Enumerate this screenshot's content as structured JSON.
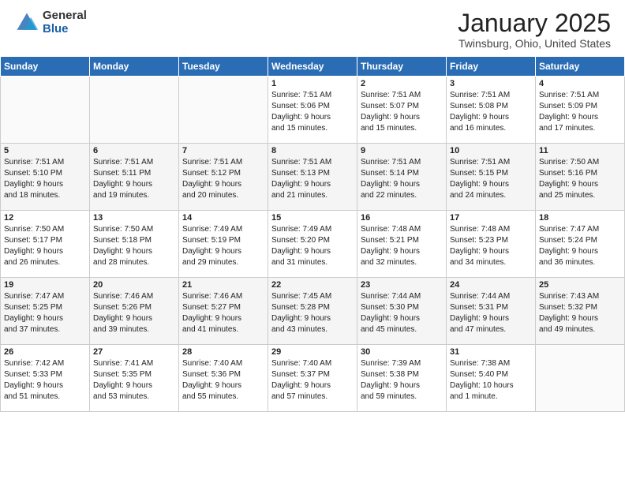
{
  "logo": {
    "general": "General",
    "blue": "Blue"
  },
  "header": {
    "month": "January 2025",
    "location": "Twinsburg, Ohio, United States"
  },
  "weekdays": [
    "Sunday",
    "Monday",
    "Tuesday",
    "Wednesday",
    "Thursday",
    "Friday",
    "Saturday"
  ],
  "weeks": [
    [
      {
        "day": null,
        "info": ""
      },
      {
        "day": null,
        "info": ""
      },
      {
        "day": null,
        "info": ""
      },
      {
        "day": "1",
        "info": "Sunrise: 7:51 AM\nSunset: 5:06 PM\nDaylight: 9 hours\nand 15 minutes."
      },
      {
        "day": "2",
        "info": "Sunrise: 7:51 AM\nSunset: 5:07 PM\nDaylight: 9 hours\nand 15 minutes."
      },
      {
        "day": "3",
        "info": "Sunrise: 7:51 AM\nSunset: 5:08 PM\nDaylight: 9 hours\nand 16 minutes."
      },
      {
        "day": "4",
        "info": "Sunrise: 7:51 AM\nSunset: 5:09 PM\nDaylight: 9 hours\nand 17 minutes."
      }
    ],
    [
      {
        "day": "5",
        "info": "Sunrise: 7:51 AM\nSunset: 5:10 PM\nDaylight: 9 hours\nand 18 minutes."
      },
      {
        "day": "6",
        "info": "Sunrise: 7:51 AM\nSunset: 5:11 PM\nDaylight: 9 hours\nand 19 minutes."
      },
      {
        "day": "7",
        "info": "Sunrise: 7:51 AM\nSunset: 5:12 PM\nDaylight: 9 hours\nand 20 minutes."
      },
      {
        "day": "8",
        "info": "Sunrise: 7:51 AM\nSunset: 5:13 PM\nDaylight: 9 hours\nand 21 minutes."
      },
      {
        "day": "9",
        "info": "Sunrise: 7:51 AM\nSunset: 5:14 PM\nDaylight: 9 hours\nand 22 minutes."
      },
      {
        "day": "10",
        "info": "Sunrise: 7:51 AM\nSunset: 5:15 PM\nDaylight: 9 hours\nand 24 minutes."
      },
      {
        "day": "11",
        "info": "Sunrise: 7:50 AM\nSunset: 5:16 PM\nDaylight: 9 hours\nand 25 minutes."
      }
    ],
    [
      {
        "day": "12",
        "info": "Sunrise: 7:50 AM\nSunset: 5:17 PM\nDaylight: 9 hours\nand 26 minutes."
      },
      {
        "day": "13",
        "info": "Sunrise: 7:50 AM\nSunset: 5:18 PM\nDaylight: 9 hours\nand 28 minutes."
      },
      {
        "day": "14",
        "info": "Sunrise: 7:49 AM\nSunset: 5:19 PM\nDaylight: 9 hours\nand 29 minutes."
      },
      {
        "day": "15",
        "info": "Sunrise: 7:49 AM\nSunset: 5:20 PM\nDaylight: 9 hours\nand 31 minutes."
      },
      {
        "day": "16",
        "info": "Sunrise: 7:48 AM\nSunset: 5:21 PM\nDaylight: 9 hours\nand 32 minutes."
      },
      {
        "day": "17",
        "info": "Sunrise: 7:48 AM\nSunset: 5:23 PM\nDaylight: 9 hours\nand 34 minutes."
      },
      {
        "day": "18",
        "info": "Sunrise: 7:47 AM\nSunset: 5:24 PM\nDaylight: 9 hours\nand 36 minutes."
      }
    ],
    [
      {
        "day": "19",
        "info": "Sunrise: 7:47 AM\nSunset: 5:25 PM\nDaylight: 9 hours\nand 37 minutes."
      },
      {
        "day": "20",
        "info": "Sunrise: 7:46 AM\nSunset: 5:26 PM\nDaylight: 9 hours\nand 39 minutes."
      },
      {
        "day": "21",
        "info": "Sunrise: 7:46 AM\nSunset: 5:27 PM\nDaylight: 9 hours\nand 41 minutes."
      },
      {
        "day": "22",
        "info": "Sunrise: 7:45 AM\nSunset: 5:28 PM\nDaylight: 9 hours\nand 43 minutes."
      },
      {
        "day": "23",
        "info": "Sunrise: 7:44 AM\nSunset: 5:30 PM\nDaylight: 9 hours\nand 45 minutes."
      },
      {
        "day": "24",
        "info": "Sunrise: 7:44 AM\nSunset: 5:31 PM\nDaylight: 9 hours\nand 47 minutes."
      },
      {
        "day": "25",
        "info": "Sunrise: 7:43 AM\nSunset: 5:32 PM\nDaylight: 9 hours\nand 49 minutes."
      }
    ],
    [
      {
        "day": "26",
        "info": "Sunrise: 7:42 AM\nSunset: 5:33 PM\nDaylight: 9 hours\nand 51 minutes."
      },
      {
        "day": "27",
        "info": "Sunrise: 7:41 AM\nSunset: 5:35 PM\nDaylight: 9 hours\nand 53 minutes."
      },
      {
        "day": "28",
        "info": "Sunrise: 7:40 AM\nSunset: 5:36 PM\nDaylight: 9 hours\nand 55 minutes."
      },
      {
        "day": "29",
        "info": "Sunrise: 7:40 AM\nSunset: 5:37 PM\nDaylight: 9 hours\nand 57 minutes."
      },
      {
        "day": "30",
        "info": "Sunrise: 7:39 AM\nSunset: 5:38 PM\nDaylight: 9 hours\nand 59 minutes."
      },
      {
        "day": "31",
        "info": "Sunrise: 7:38 AM\nSunset: 5:40 PM\nDaylight: 10 hours\nand 1 minute."
      },
      {
        "day": null,
        "info": ""
      }
    ]
  ]
}
